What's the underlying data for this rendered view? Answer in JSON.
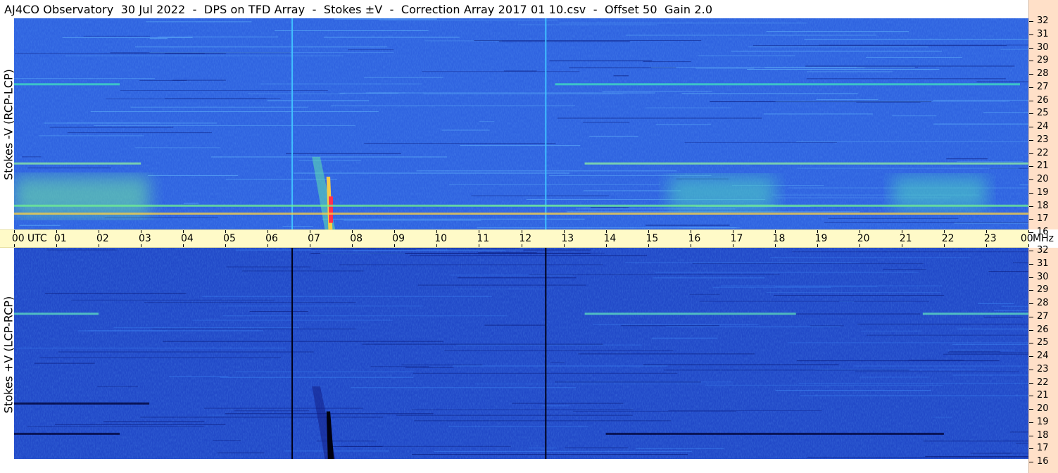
{
  "title": "AJ4CO Observatory  30 Jul 2022  -  DPS on TFD Array  -  Stokes ±V  -  Correction Array 2017 01 10.csv  -  Offset 50  Gain 2.0",
  "chart_data": [
    {
      "type": "heatmap",
      "panel": "top",
      "ylabel": "Stokes -V (RCP-LCP)",
      "xlabel": "UTC",
      "x_unit": "hours UTC",
      "xlim": [
        0,
        24
      ],
      "y_unit": "MHz",
      "ylim": [
        16,
        32
      ],
      "colormap": [
        "#0a1a8c",
        "#1f4fd8",
        "#3a82f0",
        "#3fd0e8",
        "#b8f070",
        "#ffe040",
        "#ff6020",
        "#c00060"
      ],
      "background_color": "#2f63e0",
      "features": [
        {
          "kind": "vertical_line",
          "x": 6.58,
          "color": "#40c0ff"
        },
        {
          "kind": "vertical_line",
          "x": 12.58,
          "color": "#40c0ff"
        },
        {
          "kind": "burst",
          "x_start": 7.05,
          "x_end": 7.6,
          "y_start": 16,
          "y_end": 21.5,
          "peak": "#ff3050"
        },
        {
          "kind": "band",
          "y": 27,
          "x_ranges": [
            [
              0,
              2.5
            ],
            [
              12.8,
              23.8
            ]
          ],
          "color": "#40e0c0"
        },
        {
          "kind": "band",
          "y": 17.2,
          "x_ranges": [
            [
              0,
              24
            ]
          ],
          "color": "#ffd040"
        },
        {
          "kind": "band",
          "y": 17.8,
          "x_ranges": [
            [
              0,
              24
            ]
          ],
          "color": "#70f090"
        },
        {
          "kind": "band",
          "y": 21,
          "x_ranges": [
            [
              0,
              3
            ],
            [
              13.5,
              24
            ]
          ],
          "color": "#90f0a0"
        },
        {
          "kind": "glow",
          "x_start": 0,
          "x_end": 3.2,
          "y_start": 17,
          "y_end": 20,
          "color": "#70e8a0"
        },
        {
          "kind": "glow",
          "x_start": 15.5,
          "x_end": 18,
          "y_start": 17.5,
          "y_end": 20,
          "color": "#50d8c0"
        },
        {
          "kind": "glow",
          "x_start": 20.8,
          "x_end": 23,
          "y_start": 17.5,
          "y_end": 20,
          "color": "#50d8c0"
        }
      ]
    },
    {
      "type": "heatmap",
      "panel": "bottom",
      "ylabel": "Stokes +V (LCP-RCP)",
      "xlabel": "UTC",
      "x_unit": "hours UTC",
      "xlim": [
        0,
        24
      ],
      "y_unit": "MHz",
      "ylim": [
        16,
        32
      ],
      "colormap": [
        "#000020",
        "#0a1a8c",
        "#1f4fd8",
        "#3a82f0",
        "#3fd0e8",
        "#b8f070"
      ],
      "background_color": "#2149c8",
      "features": [
        {
          "kind": "vertical_line",
          "x": 6.58,
          "color": "#000018"
        },
        {
          "kind": "vertical_line",
          "x": 12.58,
          "color": "#000018"
        },
        {
          "kind": "burst",
          "x_start": 7.05,
          "x_end": 7.6,
          "y_start": 16,
          "y_end": 21.5,
          "peak": "#000010"
        },
        {
          "kind": "band",
          "y": 27,
          "x_ranges": [
            [
              0,
              2.0
            ],
            [
              13.5,
              18.5
            ],
            [
              21.5,
              24
            ]
          ],
          "color": "#60e0c0"
        },
        {
          "kind": "band",
          "y": 17.9,
          "x_ranges": [
            [
              0,
              2.5
            ],
            [
              14,
              22
            ]
          ],
          "color": "#000030"
        },
        {
          "kind": "band",
          "y": 20.2,
          "x_ranges": [
            [
              0,
              3.2
            ]
          ],
          "color": "#000030"
        }
      ]
    }
  ],
  "time_axis": {
    "labels": [
      "00",
      "01",
      "02",
      "03",
      "04",
      "05",
      "06",
      "07",
      "08",
      "09",
      "10",
      "11",
      "12",
      "13",
      "14",
      "15",
      "16",
      "17",
      "18",
      "19",
      "20",
      "21",
      "22",
      "23",
      "00"
    ],
    "unit_label": "UTC",
    "freq_unit_label": "MHz"
  },
  "freq_axis": {
    "labels": [
      "32",
      "31",
      "30",
      "29",
      "28",
      "27",
      "26",
      "25",
      "24",
      "23",
      "22",
      "21",
      "20",
      "19",
      "18",
      "17",
      "16"
    ]
  }
}
